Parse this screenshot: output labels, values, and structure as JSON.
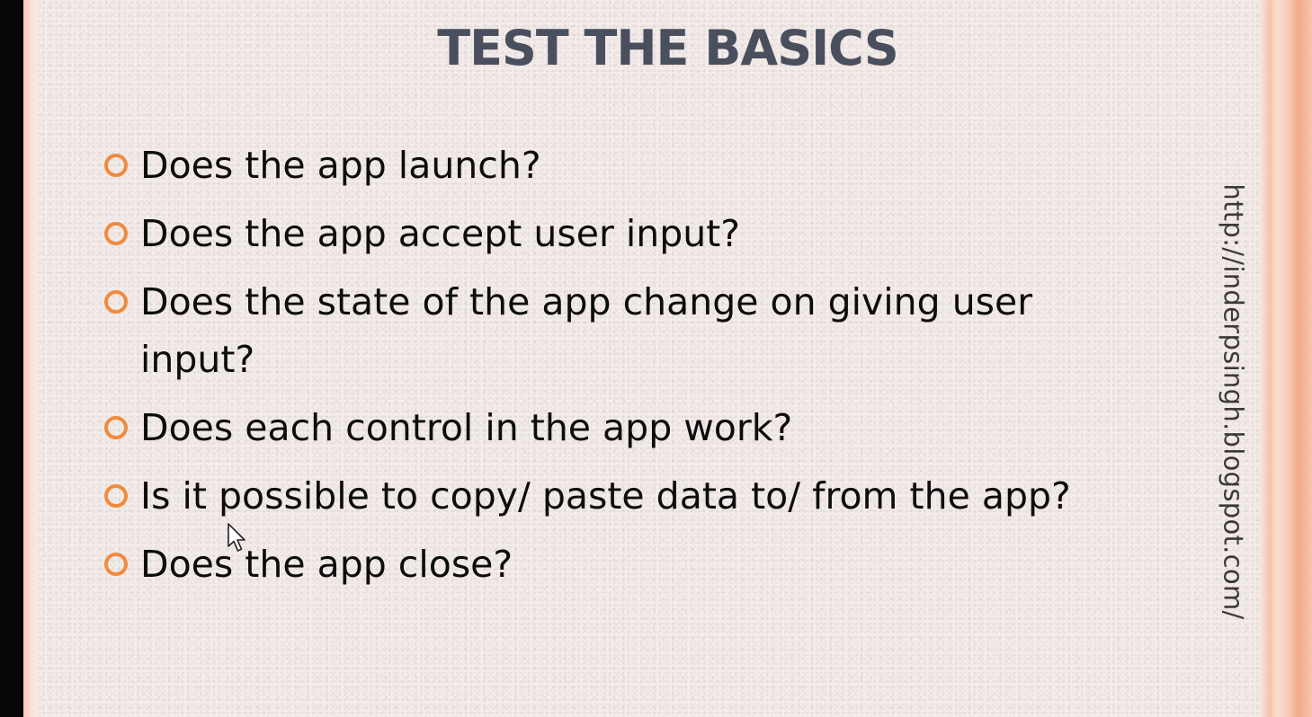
{
  "slide": {
    "title": "TEST THE BASICS",
    "bullets": [
      "Does the app launch?",
      "Does the app accept user input?",
      "Does the state of the app change on giving user input?",
      "Does each control in the app work?",
      "Is it possible to copy/ paste data to/ from the app?",
      "Does the app close?"
    ],
    "watermark_url": "http://inderpsingh.blogspot.com/"
  },
  "icons": {
    "bullet": "circle-bullet-icon",
    "pointer": "mouse-pointer-icon"
  },
  "colors": {
    "title": "#4a4f5e",
    "bullet": "#f08a3e",
    "background": "#f4ece9",
    "border_accent": "#f6c3ad"
  }
}
